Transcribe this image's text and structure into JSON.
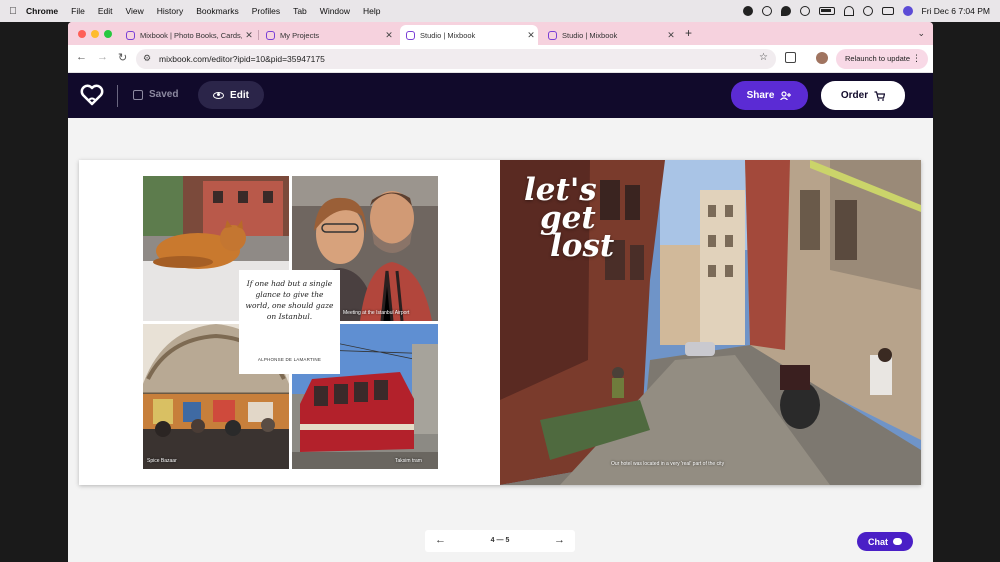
{
  "menubar": {
    "app": "Chrome",
    "items": [
      "File",
      "Edit",
      "View",
      "History",
      "Bookmarks",
      "Profiles",
      "Tab",
      "Window",
      "Help"
    ],
    "clock": "Fri Dec 6  7:04 PM"
  },
  "browser": {
    "tabs": [
      {
        "label": "Mixbook | Photo Books, Cards, Calendars",
        "active": false
      },
      {
        "label": "My Projects",
        "active": false
      },
      {
        "label": "Studio | Mixbook",
        "active": true
      },
      {
        "label": "Studio | Mixbook",
        "active": false
      }
    ],
    "url": "mixbook.com/editor?ipid=10&pid=35947175",
    "relaunch_label": "Relaunch to update"
  },
  "editor": {
    "saved_label": "Saved",
    "edit_label": "Edit",
    "share_label": "Share",
    "order_label": "Order",
    "chat_label": "Chat",
    "page_indicator": "4 — 5"
  },
  "spread": {
    "quote": "If one had but a single glance to give the world, one should gaze on Istanbul.",
    "quote_author": "ALPHONSE DE LAMARTINE",
    "captions": {
      "airport": "Meeting at the Istanbul Airport",
      "bazaar": "Spice Bazaar",
      "tram": "Taksim tram",
      "street": "Our hotel was located in a very 'real' part of the city"
    },
    "title_lines": [
      "let's",
      "get",
      "lost"
    ]
  },
  "colors": {
    "header_bg": "#110a2b",
    "accent": "#5b2bd4",
    "tabstrip": "#f6d2de"
  }
}
